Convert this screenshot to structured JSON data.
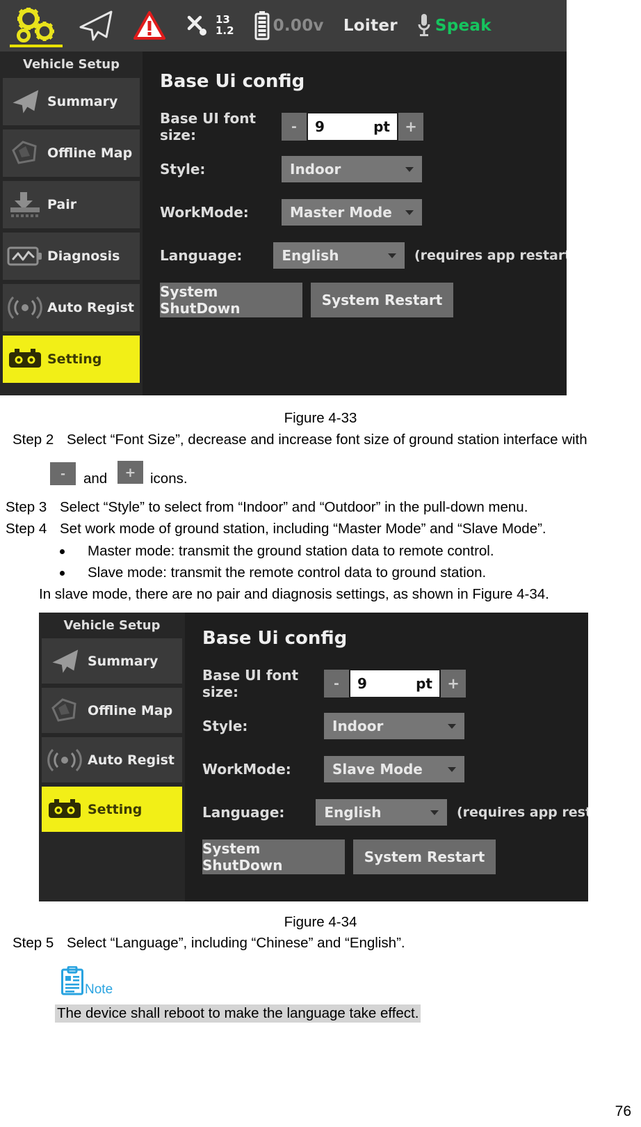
{
  "figure1": {
    "caption": "Figure 4-33",
    "topbar": {
      "items": [
        {
          "icon": "gears-icon",
          "label": "",
          "active": true
        },
        {
          "icon": "paper-plane-icon",
          "label": ""
        },
        {
          "icon": "warning-triangle-icon",
          "label": ""
        },
        {
          "icon": "satellite-icon",
          "label": ""
        },
        {
          "icon": "battery-icon",
          "label": "0.00v"
        },
        {
          "icon": "",
          "label": "Loiter"
        },
        {
          "icon": "microphone-icon",
          "label": "Speak"
        }
      ],
      "satellite_count": "13",
      "satellite_hdop": "1.2",
      "battery_voltage": "0.00v",
      "flight_mode": "Loiter",
      "speak_label": "Speak"
    },
    "sidebar": {
      "title": "Vehicle Setup",
      "items": [
        {
          "label": "Summary",
          "icon": "paper-plane-icon",
          "selected": false
        },
        {
          "label": "Offline Map",
          "icon": "polygon-map-icon",
          "selected": false
        },
        {
          "label": "Pair",
          "icon": "pair-download-icon",
          "selected": false
        },
        {
          "label": "Diagnosis",
          "icon": "diagnosis-battery-icon",
          "selected": false
        },
        {
          "label": "Auto Regist",
          "icon": "signal-waves-icon",
          "selected": false
        },
        {
          "label": "Setting",
          "icon": "setting-gear-icon",
          "selected": true
        }
      ]
    },
    "panel": {
      "title": "Base Ui config",
      "font_size_label": "Base UI font size:",
      "font_size_value": "9",
      "font_size_unit": "pt",
      "decrease_label": "-",
      "increase_label": "+",
      "style_label": "Style:",
      "style_value": "Indoor",
      "workmode_label": "WorkMode:",
      "workmode_value": "Master Mode",
      "language_label": "Language:",
      "language_value": "English",
      "language_hint": "(requires app restart)",
      "shutdown_label": "System ShutDown",
      "restart_label": "System Restart"
    }
  },
  "figure2": {
    "caption": "Figure 4-34",
    "sidebar": {
      "title": "Vehicle Setup",
      "items": [
        {
          "label": "Summary",
          "icon": "paper-plane-icon",
          "selected": false
        },
        {
          "label": "Offline Map",
          "icon": "polygon-map-icon",
          "selected": false
        },
        {
          "label": "Auto Regist",
          "icon": "signal-waves-icon",
          "selected": false
        },
        {
          "label": "Setting",
          "icon": "setting-gear-icon",
          "selected": true
        }
      ]
    },
    "panel": {
      "title": "Base Ui config",
      "font_size_label": "Base UI font size:",
      "font_size_value": "9",
      "font_size_unit": "pt",
      "decrease_label": "-",
      "increase_label": "+",
      "style_label": "Style:",
      "style_value": "Indoor",
      "workmode_label": "WorkMode:",
      "workmode_value": "Slave Mode",
      "language_label": "Language:",
      "language_value": "English",
      "language_hint": "(requires app restart)",
      "shutdown_label": "System ShutDown",
      "restart_label": "System Restart"
    }
  },
  "body": {
    "step2_prefix": "Step 2",
    "step2_text": "Select “Font Size”, decrease and increase font size of ground station interface with",
    "step2_and": "and",
    "step2_tail": "icons.",
    "step2_minus": "-",
    "step2_plus": "+",
    "step3_prefix": "Step 3",
    "step3_text": "Select “Style” to select from “Indoor” and “Outdoor” in the pull-down menu.",
    "step4_prefix": "Step 4",
    "step4_text": "Set work mode of ground station, including “Master Mode” and “Slave Mode”.",
    "bullet1": "Master mode: transmit the ground station data to remote control.",
    "bullet2": "Slave mode: transmit the remote control data to ground station.",
    "paragraph1": "In slave mode, there are no pair and diagnosis settings, as shown in Figure 4-34.",
    "step5_prefix": "Step 5",
    "step5_text": "Select “Language”, including “Chinese” and “English”.",
    "note_label": "Note",
    "note_text": "The device shall reboot to make the language take effect.",
    "page_number": "76"
  },
  "colors": {
    "accent_yellow": "#f2ef17",
    "app_bg": "#1e1e1e",
    "topbar_bg": "#3d3d3d",
    "sidebar_item_bg": "#3a3a3a",
    "combo_bg": "#767676",
    "note_blue": "#29a3e0",
    "speak_green": "#16c45e"
  }
}
